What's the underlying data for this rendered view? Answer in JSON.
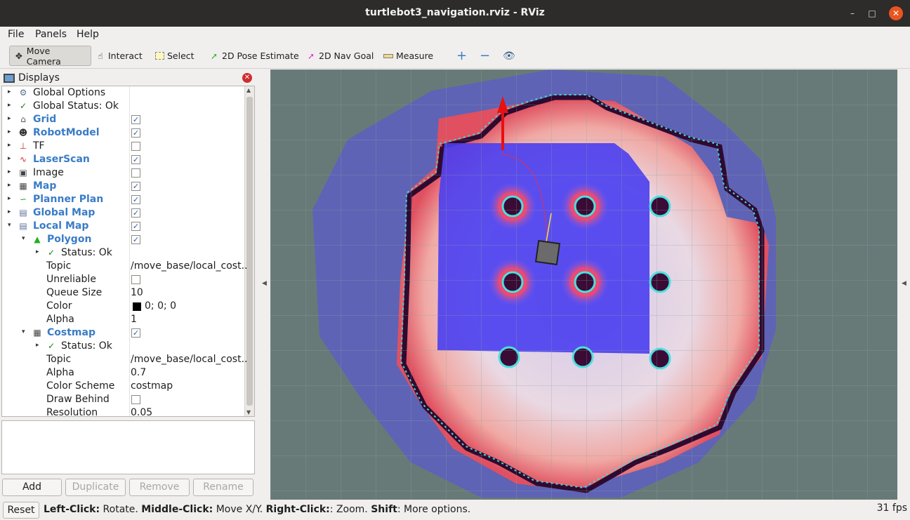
{
  "window": {
    "title": "turtlebot3_navigation.rviz - RViz"
  },
  "menu": {
    "file": "File",
    "panels": "Panels",
    "help": "Help"
  },
  "toolbar": {
    "move_camera": "Move Camera",
    "interact": "Interact",
    "select": "Select",
    "pose_estimate": "2D Pose Estimate",
    "nav_goal": "2D Nav Goal",
    "measure": "Measure"
  },
  "displays": {
    "title": "Displays",
    "rows": [
      {
        "name": "Global Options",
        "value": ""
      },
      {
        "name": "Global Status: Ok",
        "value": ""
      },
      {
        "name": "Grid",
        "value": ""
      },
      {
        "name": "RobotModel",
        "value": ""
      },
      {
        "name": "TF",
        "value": ""
      },
      {
        "name": "LaserScan",
        "value": ""
      },
      {
        "name": "Image",
        "value": ""
      },
      {
        "name": "Map",
        "value": ""
      },
      {
        "name": "Planner Plan",
        "value": ""
      },
      {
        "name": "Global Map",
        "value": ""
      },
      {
        "name": "Local Map",
        "value": ""
      },
      {
        "name": "Polygon",
        "value": ""
      },
      {
        "name": "Status: Ok",
        "value": ""
      },
      {
        "name": "Topic",
        "value": "/move_base/local_cost..."
      },
      {
        "name": "Unreliable",
        "value": ""
      },
      {
        "name": "Queue Size",
        "value": "10"
      },
      {
        "name": "Color",
        "value": "0; 0; 0"
      },
      {
        "name": "Alpha",
        "value": "1"
      },
      {
        "name": "Costmap",
        "value": ""
      },
      {
        "name": "Status: Ok",
        "value": ""
      },
      {
        "name": "Topic",
        "value": "/move_base/local_cost..."
      },
      {
        "name": "Alpha",
        "value": "0.7"
      },
      {
        "name": "Color Scheme",
        "value": "costmap"
      },
      {
        "name": "Draw Behind",
        "value": ""
      },
      {
        "name": "Resolution",
        "value": "0.05"
      }
    ]
  },
  "buttons": {
    "add": "Add",
    "duplicate": "Duplicate",
    "remove": "Remove",
    "rename": "Rename"
  },
  "status": {
    "reset": "Reset",
    "left_click": "Left-Click:",
    "left_desc": " Rotate. ",
    "middle_click": "Middle-Click:",
    "middle_desc": " Move X/Y. ",
    "right_click": "Right-Click:",
    "right_desc": ": Zoom. ",
    "shift": "Shift",
    "shift_desc": ": More options.",
    "fps": "31 fps"
  }
}
